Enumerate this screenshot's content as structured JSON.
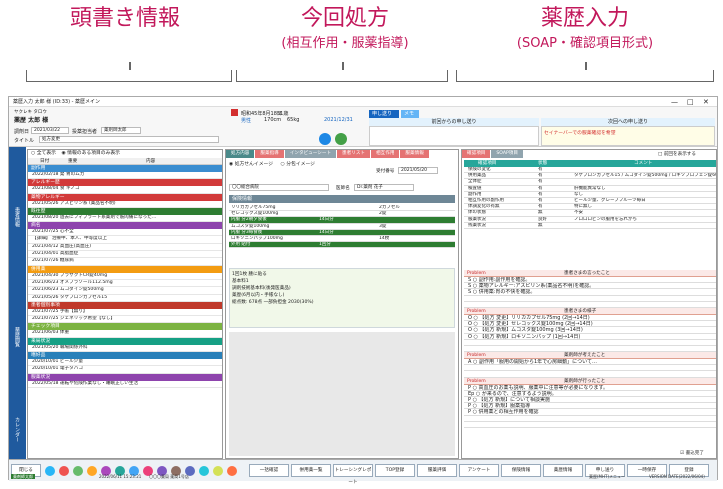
{
  "headers": [
    {
      "title": "頭書き情報",
      "sub": ""
    },
    {
      "title": "今回処方",
      "sub": "(相互作用・服薬指導)"
    },
    {
      "title": "薬歴入力",
      "sub": "(SOAP・確認項目形式)"
    }
  ],
  "window": {
    "title": "薬歴入力 太郎 様 (ID:33) - 薬歴メイン",
    "controls": [
      "—",
      "□",
      "✕"
    ]
  },
  "patient": {
    "kana": "ヤクレキ タロウ",
    "name": "薬歴 太郎 様",
    "birth": "昭和45年8月18日",
    "age": "51歳",
    "sex": "男性",
    "height": "170cm",
    "weight": "65kg",
    "clinic_label": "調剤日",
    "clinic_date": "2021/03/22",
    "pharmacist_label": "投薬担当者",
    "pharmacist": "薬剤師太郎",
    "title_label": "タイトル",
    "title_value": "処方変更",
    "insurance_date": "2021/12/31",
    "msg_tab": "申し送り",
    "msg_tab2": "メモ",
    "prev_msg_label": "前回からの申し送り",
    "next_msg_label": "次回への申し送り",
    "next_msg_note": "セイナーバーでの服薬確認を希望"
  },
  "ribbon": [
    "患者情報",
    "薬歴閲覧",
    "カレンダー"
  ],
  "left": {
    "radio_all": "全て表示",
    "radio_info": "情報のある項目のみ表示",
    "col1": "日付",
    "col2": "重要",
    "col3": "内容",
    "sections": [
      {
        "label": "副作用",
        "color": "#3a8dd0",
        "rows": [
          "2022/02/18 発 胃のムカ"
        ]
      },
      {
        "label": "アレルギー歴",
        "color": "#d23a3a",
        "rows": [
          "2021/08/04 食 キノコ"
        ]
      },
      {
        "label": "薬物アレルギー",
        "color": "#d23a3a",
        "rows": [
          "2021/05/26 アスピリン系 (薬品名不明)"
        ]
      },
      {
        "label": "既往歴",
        "color": "#2e7d32",
        "rows": [
          "2021/08/20 過去にフィブラート系薬剤で筋肉痛になった…"
        ]
      },
      {
        "label": "病名",
        "color": "#8e44ad",
        "rows": [
          "2021/07/25 心不全",
          "【詳細】 治療中、本人、中等度以上",
          "2021/04/12 高血圧(高血圧)",
          "2021/04/01 高脂血症",
          "2021/07/26 糖尿病"
        ]
      },
      {
        "label": "併用薬",
        "color": "#f39c12",
        "rows": [
          "2021/04/30 プラザクトCR錠40mg",
          "2021/06/23 オメプラゾール112.5mg",
          "2021/06/23 ムコダイン錠500mg",
          "2021/05/26 タケプロンカプセル15"
        ]
      },
      {
        "label": "患者個別事項",
        "color": "#c0392b",
        "rows": [
          "2021/07/25 手帳【無り】",
          "2021/07/25 ジェネリック希望【なし】"
        ]
      },
      {
        "label": "チェック項目",
        "color": "#7cb342",
        "rows": [
          "2021/06/03 体重"
        ]
      },
      {
        "label": "来局状況",
        "color": "#16a085",
        "rows": [
          "2021/05/20 職場関係外科"
        ]
      },
      {
        "label": "嗜好品",
        "color": "#2980b9",
        "rows": [
          "2020/10/01 ビール少量",
          "2020/10/01 電子タバコ"
        ]
      },
      {
        "label": "服薬状況",
        "color": "#8e44ad",
        "rows": [
          "2022/05/18 運転や危険作業なし・睡眠正しい生活"
        ]
      }
    ]
  },
  "middle": {
    "tabs": [
      "処方内容",
      "服薬指導",
      "インタビューシート",
      "患者リスト",
      "相互作用",
      "服薬情報"
    ],
    "subtabs": [
      "処方せんイメージ",
      "分包イメージ"
    ],
    "clinic_label": "受付番号",
    "clinic_no": "2021/05/20",
    "hospital": "〇〇総合病院",
    "doctor_label": "医師名",
    "doctor": "Dr.薬剤 花子",
    "insurance_label": "保険情報",
    "drugs": [
      {
        "name": "リリカカプセル75mg",
        "qty": "2カプセル",
        "days": ""
      },
      {
        "name": "セレコックス錠100mg",
        "qty": "2錠",
        "days": ""
      },
      {
        "name": "内服 分2朝夕食後",
        "qty": "",
        "days": "14日分"
      },
      {
        "name": "ムコスタ錠100mg",
        "qty": "3錠",
        "days": ""
      },
      {
        "name": "内服 分3毎食後",
        "qty": "",
        "days": "14日分"
      },
      {
        "name": "ロキソニンパップ100mg",
        "qty": "14枚",
        "days": ""
      },
      {
        "name": "外用 貼付",
        "qty": "",
        "days": "1回分"
      }
    ],
    "note_lines": [
      "1回1枚 腰に貼る",
      "基本料1",
      "調剤技術基本料(後発医薬品)",
      "薬歴(6月以内・手帳なし)",
      "総点数: 678点  一部負担金 2030(30%)"
    ]
  },
  "right": {
    "tab1": "確認項目",
    "tab2": "SOAP項目",
    "checkbox": "前回を表示する",
    "col1": "確認項目",
    "col2": "状態",
    "col3": "コメント",
    "items": [
      {
        "item": "保険の変化",
        "state": "有",
        "comment": ""
      },
      {
        "item": "併用薬品",
        "state": "有",
        "comment": "タケプロンカプセル15 / ムコダイン錠500mg / ロキソプロフェン錠60mg"
      },
      {
        "item": "全体症",
        "state": "有",
        "comment": ""
      },
      {
        "item": "検査値",
        "state": "有",
        "comment": "肝機能異常なし"
      },
      {
        "item": "副作用",
        "state": "有",
        "comment": "なし"
      },
      {
        "item": "相互作用の副作用",
        "state": "有",
        "comment": "ビール少量、グレープフルーツ毎日"
      },
      {
        "item": "体調変化の有無",
        "state": "有",
        "comment": "特に無し"
      },
      {
        "item": "体の状態",
        "state": "無",
        "comment": "不安"
      },
      {
        "item": "服薬状況",
        "state": "良好",
        "comment": "ノロロロピンの服用を忘れがち"
      },
      {
        "item": "残薬状況",
        "state": "無",
        "comment": ""
      }
    ],
    "soap_sections": [
      {
        "title": "患者さまの言ったこと",
        "rows": [
          "S ○ 副作用:副作用を確認。",
          "S ○ 薬物アレルギー:アスピリン系(薬品名不明)を確認。",
          "S ○ 併用薬:胃の不快を確認。"
        ]
      },
      {
        "title": "患者さまの様子",
        "rows": [
          "O ○ 【処方 変更】リリカカプセル75mg (2回→14日)",
          "O ○ 【処方 変更】セレコックス錠100mg (2回→14日)",
          "O ○ 【処方 新規】ムコスタ錠100mg (3回→14日)",
          "O ○ 【処方 新規】ロキソニンパップ (1回→14日)"
        ]
      },
      {
        "title": "薬剤師が考えたこと",
        "rows": [
          "A ○ 副作用「服用の開始から1年で心房細動」について…"
        ]
      },
      {
        "title": "薬剤師が行ったこと",
        "rows": [
          "P ○ 高血圧のお薬も説明、服薬中に注意等が必要になります。",
          "Ep ○ が来るので、注意するよう説明。",
          "P ○ 【処方 新規】について相談実施",
          "P ○ 【処方 新規】服薬指導",
          "P ○ 併用薬との相互作用を確認"
        ]
      }
    ],
    "soap_label": "Problem",
    "done_check": "書込完了"
  },
  "bottom": {
    "close": "閉じる",
    "btn_labels": [
      "一括確認",
      "併用薬一覧",
      "トレーシングレポート",
      "TOP登録",
      "服薬評価",
      "アンケート",
      "保険情報",
      "薬歴情報",
      "申し送り",
      "一時保存",
      "登録"
    ],
    "status_left": "薬剤師太郎",
    "status_date": "2022/06/11 15:23:21",
    "status_clinic": "〇〇〇薬局 薬局1号店",
    "status_right": "VERSION DATE(2022/06/04)",
    "menu": "薬歴(MHT)メニュー"
  }
}
